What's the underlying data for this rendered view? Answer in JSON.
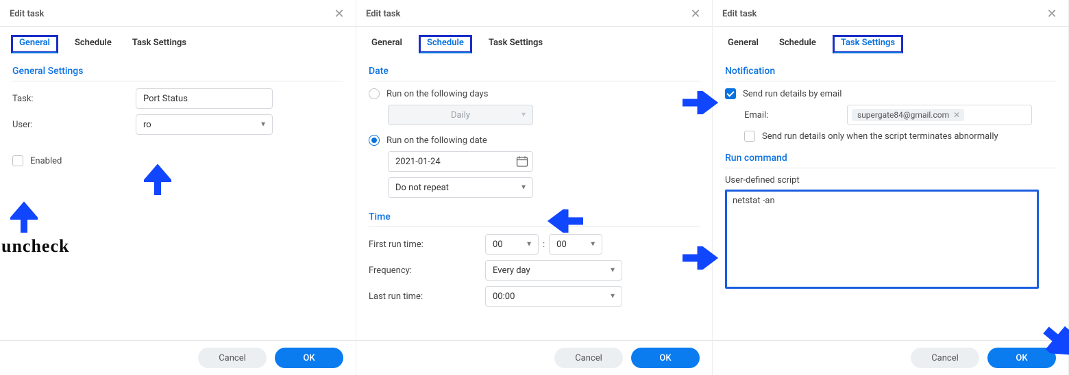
{
  "dialogs": {
    "title": "Edit task",
    "tabs": {
      "general": "General",
      "schedule": "Schedule",
      "task_settings": "Task Settings"
    },
    "buttons": {
      "cancel": "Cancel",
      "ok": "OK"
    }
  },
  "panel1": {
    "section": "General Settings",
    "task_label": "Task:",
    "task_value": "Port Status",
    "user_label": "User:",
    "user_value": "ro",
    "enabled_label": "Enabled",
    "annotation": "uncheck"
  },
  "panel2": {
    "date_section": "Date",
    "run_days_label": "Run on the following days",
    "daily": "Daily",
    "run_date_label": "Run on the following date",
    "date_value": "2021-01-24",
    "repeat_value": "Do not repeat",
    "time_section": "Time",
    "first_run_label": "First run time:",
    "hour": "00",
    "minute": "00",
    "freq_label": "Frequency:",
    "freq_value": "Every day",
    "last_run_label": "Last run time:",
    "last_run_value": "00:00"
  },
  "panel3": {
    "notif_section": "Notification",
    "send_label": "Send run details by email",
    "email_label": "Email:",
    "email_value": "supergate84@gmail.com",
    "abnormal_label": "Send run details only when the script terminates abnormally",
    "run_section": "Run command",
    "script_label": "User-defined script",
    "script_value": "netstat -an"
  }
}
